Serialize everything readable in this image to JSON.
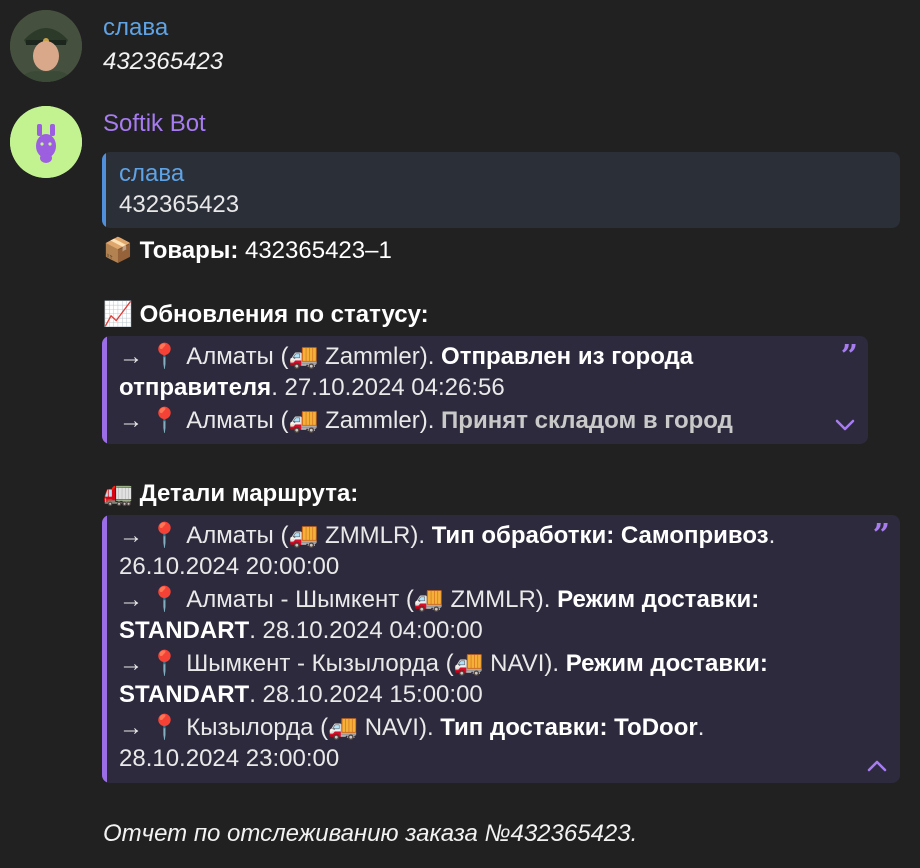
{
  "messages": [
    {
      "sender": "слава",
      "text": "432365423",
      "avatar": "soldier-avatar"
    },
    {
      "sender": "Softik Bot",
      "avatar": "llama-avatar",
      "reply": {
        "sender": "слава",
        "text": "432365423"
      },
      "goods_label": "Товары:",
      "goods_value": "432365423–1",
      "status_heading": "Обновления по статусу:",
      "status_lines": {
        "l1_pre": "→",
        "l1_city": "Алматы (",
        "l1_carrier": "Zammler).",
        "l1_bold": "Отправлен из города",
        "l2_bold": "отправителя",
        "l2_rest": ". 27.10.2024 04:26:56",
        "l3_pre": "→",
        "l3_city": "Алматы (",
        "l3_carrier": "Zammler).",
        "l3_bold": "Принят складом в город"
      },
      "route_heading": "Детали маршрута:",
      "route_lines": {
        "r1_city": "Алматы (",
        "r1_carrier": "ZMMLR).",
        "r1_bold": "Тип обработки:  Самопривоз",
        "r1_dot": ".",
        "r2": "26.10.2024 20:00:00",
        "r3_city": "Алматы - Шымкент (",
        "r3_carrier": "ZMMLR).",
        "r3_bold": "Режим доставки:",
        "r4_bold": "STANDART",
        "r4_rest": ". 28.10.2024 04:00:00",
        "r5_city": "Шымкент - Кызылорда (",
        "r5_carrier": "NAVI).",
        "r5_bold": "Режим доставки:",
        "r6_bold": "STANDART",
        "r6_rest": ". 28.10.2024 15:00:00",
        "r7_city": "Кызылорда (",
        "r7_carrier": "NAVI).",
        "r7_bold": "Тип доставки:  ToDoor",
        "r7_dot": ".",
        "r8": "28.10.2024 23:00:00"
      },
      "footer": "Отчет по отслеживанию заказа №432365423."
    }
  ],
  "icons": {
    "package": "📦",
    "chart": "📈",
    "truck_green": "🚛",
    "pin": "📍",
    "truck": "🚚",
    "arrow": "→"
  },
  "colors": {
    "background": "#212121",
    "user_name": "#5ea3e6",
    "bot_name": "#a67cf0",
    "quote_bar": "#9b6ee8",
    "reply_bar": "#4f8fdc"
  }
}
